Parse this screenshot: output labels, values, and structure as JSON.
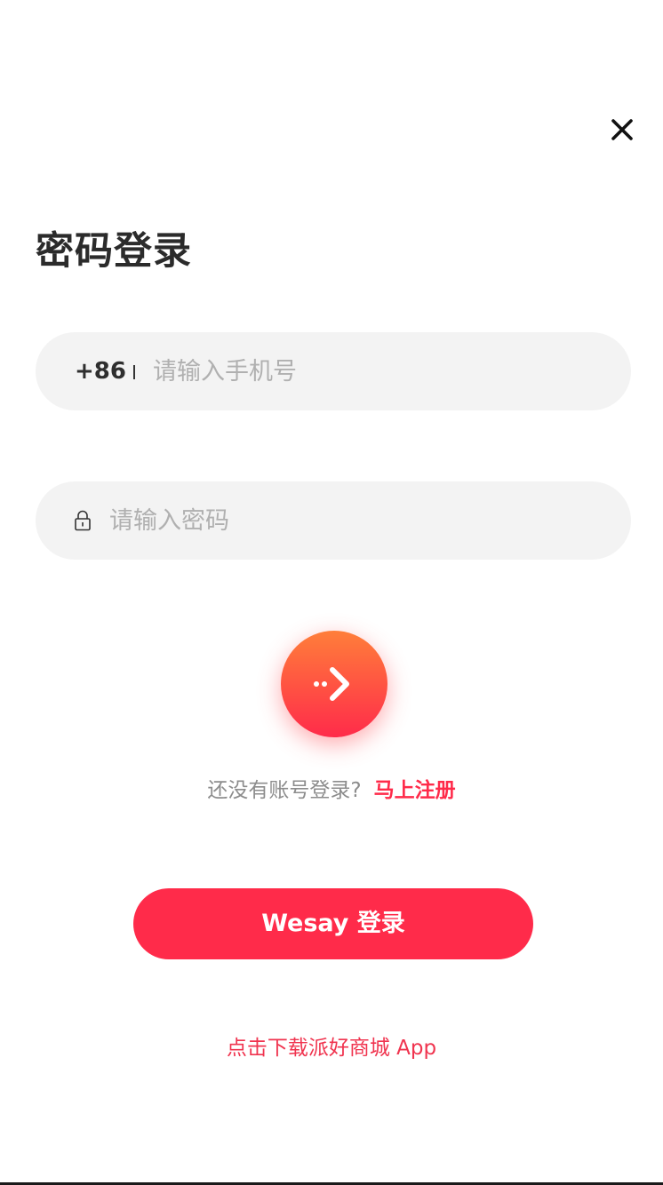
{
  "header": {
    "close_icon": "close-icon",
    "title": "密码登录"
  },
  "phone": {
    "country_code": "+86",
    "placeholder": "请输入手机号",
    "value": ""
  },
  "password": {
    "icon": "lock-icon",
    "placeholder": "请输入密码",
    "value": ""
  },
  "submit": {
    "icon": "arrow-right-icon",
    "colors": {
      "top": "#ff7e3a",
      "bottom": "#ff2b4a"
    }
  },
  "register": {
    "prompt": "还没有账号登录?",
    "link": "马上注册"
  },
  "wesay_login": {
    "label": "Wesay 登录"
  },
  "download": {
    "label": "点击下载派好商城 App"
  },
  "theme": {
    "accent": "#ff2b4a",
    "field_bg": "#f3f3f3",
    "placeholder": "#b0b0b0"
  }
}
